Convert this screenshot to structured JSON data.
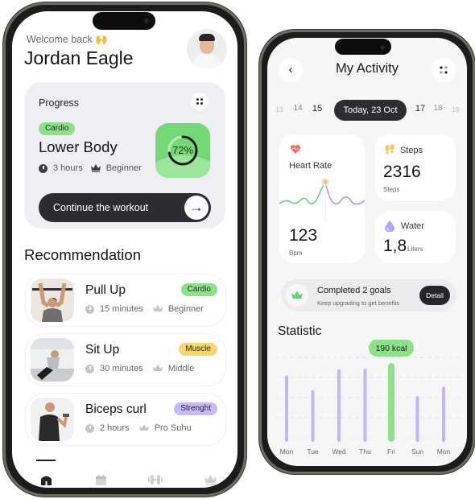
{
  "home": {
    "welcome": "Welcome back",
    "welcome_emoji": "🙌",
    "user_name": "Jordan Eagle",
    "progress": {
      "title": "Progress",
      "category": "Cardio",
      "workout": "Lower Body",
      "duration": "3 hours",
      "level": "Beginner",
      "percent_label": "72%",
      "percent": 72,
      "continue_label": "Continue the workout",
      "arrow": "→"
    },
    "recommendation_title": "Recommendation",
    "recommendations": [
      {
        "title": "Pull Up",
        "tag": "Cardio",
        "duration": "15 minutes",
        "level": "Beginner"
      },
      {
        "title": "Sit Up",
        "tag": "Muscle",
        "duration": "30 minutes",
        "level": "Middle"
      },
      {
        "title": "Biceps curl",
        "tag": "Strenght",
        "duration": "2 hours",
        "level": "Pro Suhu"
      }
    ],
    "nav": [
      "home-icon",
      "calendar-icon",
      "dumbbell-icon",
      "crown-icon"
    ],
    "active_nav": "home"
  },
  "activity": {
    "back": "‹",
    "title": "My Activity",
    "dates": [
      "13",
      "14",
      "15",
      "17",
      "18",
      "19"
    ],
    "today": "Today, 23 Oct",
    "heart": {
      "label": "Heart Rate",
      "value": "123",
      "unit": "Bpm"
    },
    "steps": {
      "label": "Steps",
      "value": "2316",
      "unit": "Steps"
    },
    "water": {
      "label": "Water",
      "value": "1,8",
      "unit": "Liters"
    },
    "goals": {
      "title": "Completed 2 goals",
      "subtitle": "Keep upgrading to get benefits",
      "button": "Detail"
    },
    "statistic_title": "Statistic"
  },
  "colors": {
    "green": "#8ee08a",
    "purple": "#c2b6f6",
    "dark": "#2c2d30",
    "yellow": "#f6d66e"
  },
  "chart_data": {
    "type": "bar",
    "title": "Statistic",
    "categories": [
      "Mon",
      "Tue",
      "Wed",
      "Thu",
      "Fri",
      "Sun",
      "Mon"
    ],
    "values": [
      160,
      125,
      175,
      177,
      190,
      110,
      133
    ],
    "unit": "kcal",
    "highlight_index": 4,
    "highlight_label": "190 kcal",
    "ylim": [
      0,
      200
    ],
    "grid": true
  }
}
